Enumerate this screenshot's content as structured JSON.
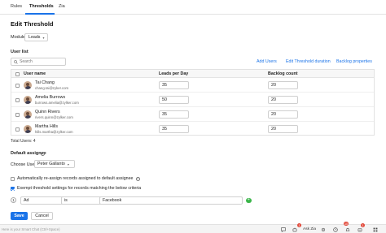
{
  "tabs": [
    {
      "label": "Rules"
    },
    {
      "label": "Thresholds"
    },
    {
      "label": "Zia"
    }
  ],
  "page_title": "Edit Threshold",
  "module": {
    "label": "Module",
    "value": "Leads"
  },
  "user_list": {
    "label": "User list",
    "search_placeholder": "Search",
    "links": {
      "add_users": "Add Users",
      "edit_duration": "Edit Threshold duration",
      "backlog_properties": "Backlog properties"
    },
    "columns": {
      "user_name": "User name",
      "leads_per_day": "Leads per Day",
      "backlog_count": "Backlog count"
    },
    "rows": [
      {
        "name": "Tai Chang",
        "email": "chang.tai@zyker.com",
        "leads_per_day": "35",
        "backlog": "20"
      },
      {
        "name": "Amelia Burrows",
        "email": "burrows.amelia@zylker.com",
        "leads_per_day": "50",
        "backlog": "20"
      },
      {
        "name": "Quinn Rivers",
        "email": "rivers.quinn@zylker.com",
        "leads_per_day": "35",
        "backlog": "20"
      },
      {
        "name": "Martha Hills",
        "email": "hills.martha@zylker.com",
        "leads_per_day": "35",
        "backlog": "20"
      }
    ],
    "total": "Total Users: 4"
  },
  "default_assignee": {
    "label": "Default assignee",
    "choose_label": "Choose User",
    "choose_value": "Peter Gallanto"
  },
  "options": {
    "auto_reassign": {
      "label": "Automatically re-assign records assigned to default assignee",
      "checked": false
    },
    "exempt": {
      "label": "Exempt threshold settings for records matching the below criteria",
      "checked": true
    }
  },
  "criteria": {
    "number": "1",
    "field": "Ad",
    "operator": "is",
    "value": "Facebook"
  },
  "buttons": {
    "save": "Save",
    "cancel": "Cancel"
  },
  "bottom_bar": {
    "smart_chat_placeholder": "Here is your Smart Chat (Ctrl+Space)",
    "ask_zia": "Ask Zia",
    "badges": {
      "first": "1",
      "second": "10",
      "third": "1"
    }
  },
  "colors": {
    "accent": "#1a73e8",
    "add": "#3bb54a",
    "badge": "#e24a3b"
  }
}
